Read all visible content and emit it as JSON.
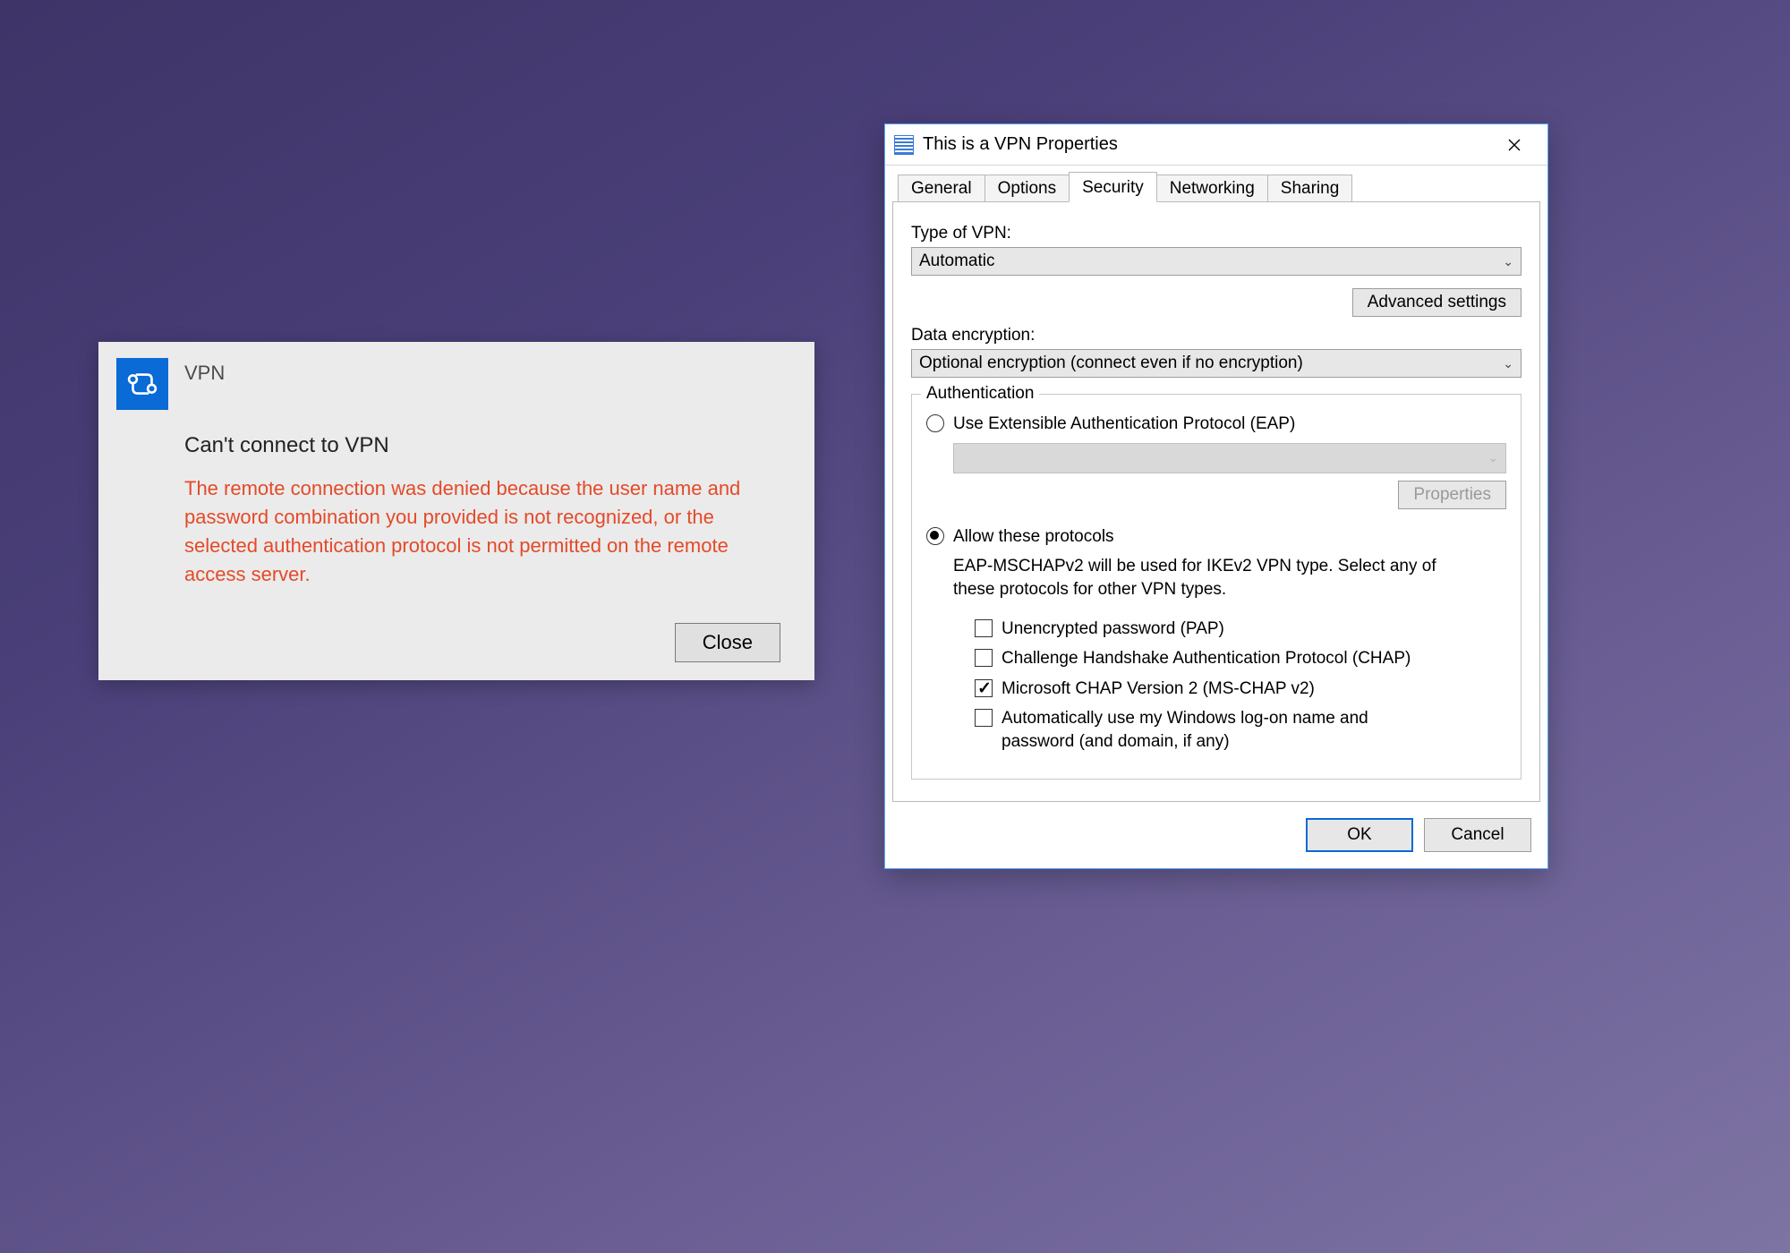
{
  "toast": {
    "app_name": "VPN",
    "subtitle": "Can't connect to VPN",
    "message": "The remote connection was denied because the user name and password combination you provided is not recognized, or the selected authentication protocol is not permitted on the remote access server.",
    "close_label": "Close"
  },
  "dialog": {
    "title": "This is a VPN Properties",
    "tabs": [
      "General",
      "Options",
      "Security",
      "Networking",
      "Sharing"
    ],
    "active_tab": "Security",
    "security": {
      "type_label": "Type of VPN:",
      "type_value": "Automatic",
      "advanced_btn": "Advanced settings",
      "encryption_label": "Data encryption:",
      "encryption_value": "Optional encryption (connect even if no encryption)",
      "auth_legend": "Authentication",
      "eap_label": "Use Extensible Authentication Protocol (EAP)",
      "eap_selected": false,
      "eap_properties_btn": "Properties",
      "allow_label": "Allow these protocols",
      "allow_selected": true,
      "allow_note": "EAP-MSCHAPv2 will be used for IKEv2 VPN type. Select any of these protocols for other VPN types.",
      "protocols": {
        "pap": {
          "label": "Unencrypted password (PAP)",
          "checked": false
        },
        "chap": {
          "label": "Challenge Handshake Authentication Protocol (CHAP)",
          "checked": false
        },
        "mschap": {
          "label": "Microsoft CHAP Version 2 (MS-CHAP v2)",
          "checked": true
        },
        "auto": {
          "label": "Automatically use my Windows log-on name and password (and domain, if any)",
          "checked": false
        }
      }
    },
    "buttons": {
      "ok": "OK",
      "cancel": "Cancel"
    }
  }
}
